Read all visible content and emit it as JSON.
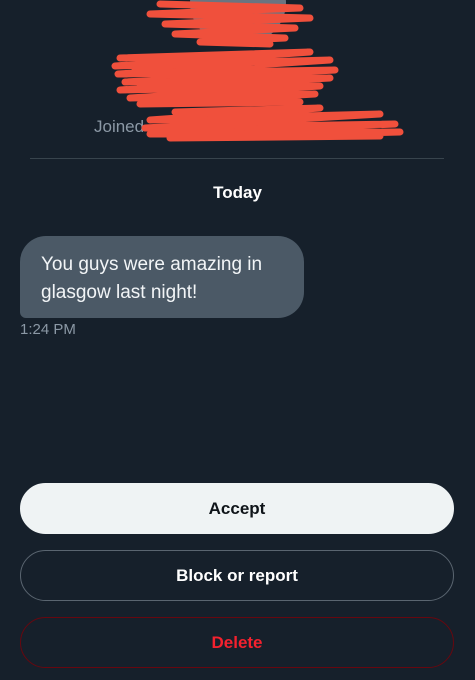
{
  "profile": {
    "joined_text": "Joined"
  },
  "conversation": {
    "date_label": "Today",
    "messages": [
      {
        "text": "You guys were amazing in glasgow last night!",
        "time": "1:24 PM"
      }
    ]
  },
  "actions": {
    "accept_label": "Accept",
    "block_label": "Block or report",
    "delete_label": "Delete"
  },
  "colors": {
    "background": "#16202b",
    "bubble": "#4b5966",
    "accept_bg": "#eff3f4",
    "delete_text": "#f4212e",
    "redaction": "#f0503c"
  }
}
